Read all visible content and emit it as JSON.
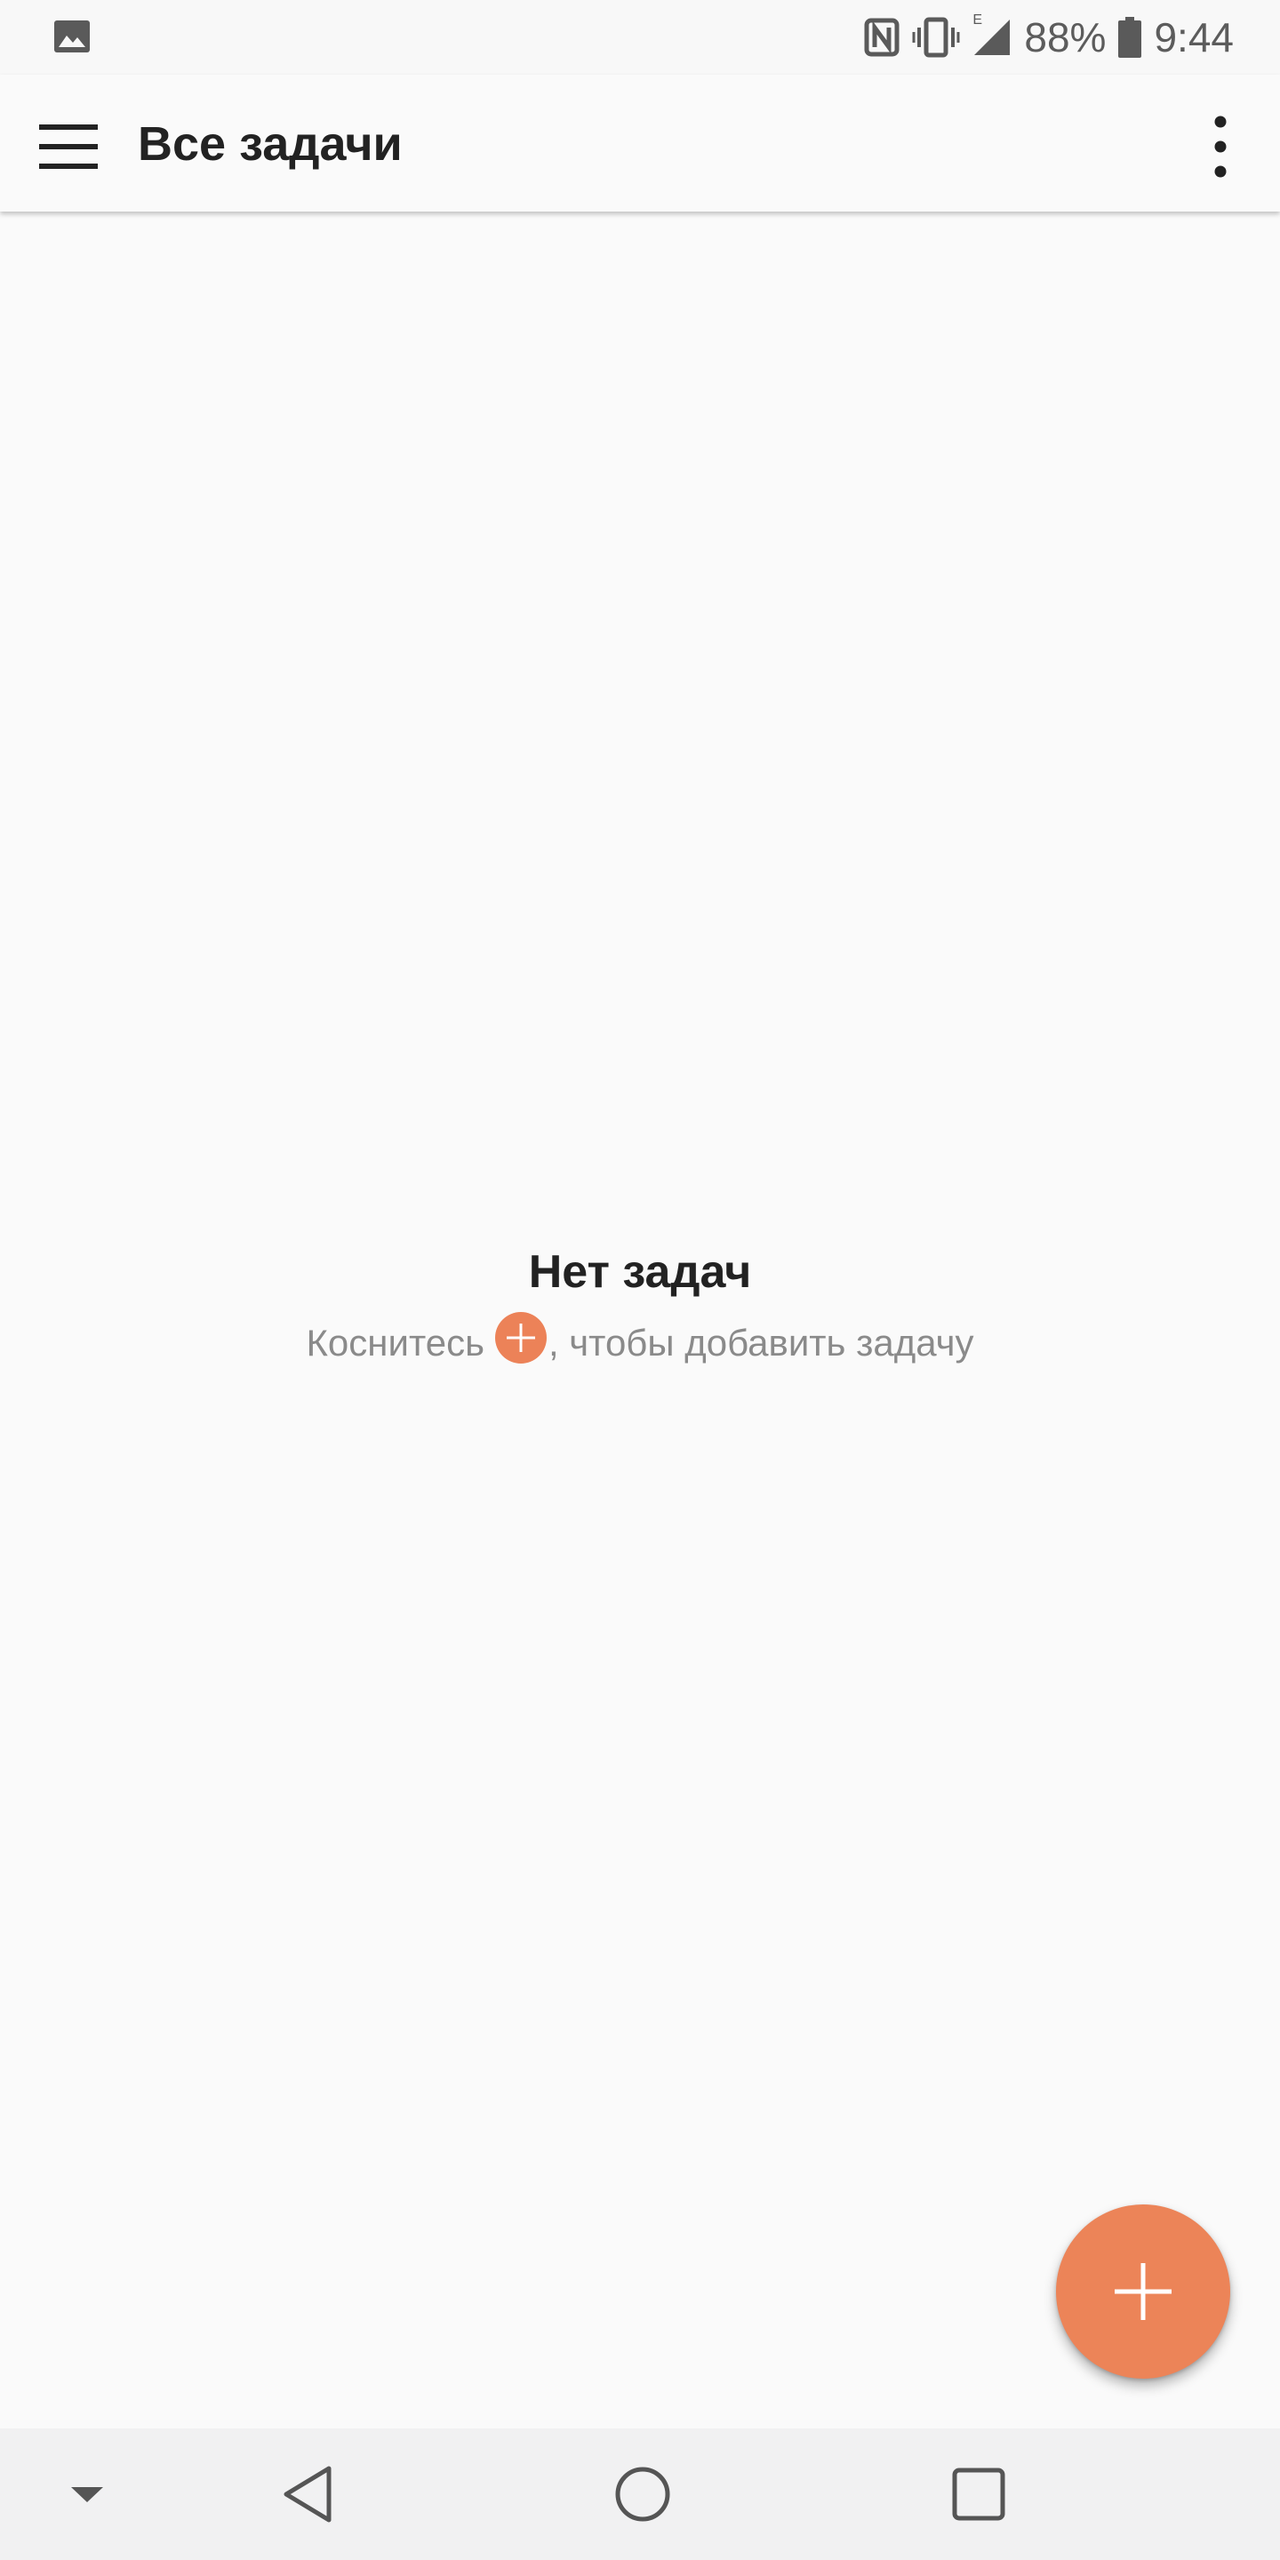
{
  "status_bar": {
    "battery_percent": "88%",
    "time": "9:44",
    "network_type": "E",
    "icons": [
      "gallery-notification-icon",
      "nfc-icon",
      "vibrate-icon",
      "signal-icon",
      "battery-icon"
    ]
  },
  "toolbar": {
    "title": "Все задачи",
    "menu_icon": "hamburger-menu-icon",
    "overflow_icon": "more-vert-icon"
  },
  "empty_state": {
    "title": "Нет задач",
    "hint_before": "Коснитесь",
    "hint_after": ", чтобы добавить задачу"
  },
  "fab": {
    "icon": "plus-icon"
  },
  "nav_bar": {
    "icons": [
      "collapse-arrow-icon",
      "back-icon",
      "home-icon",
      "recents-icon"
    ]
  },
  "colors": {
    "accent": "#ec8458",
    "background": "#fafafa",
    "title_text": "#222222",
    "hint_text": "#8a8a8a",
    "nav_background": "#f1f1f2"
  }
}
